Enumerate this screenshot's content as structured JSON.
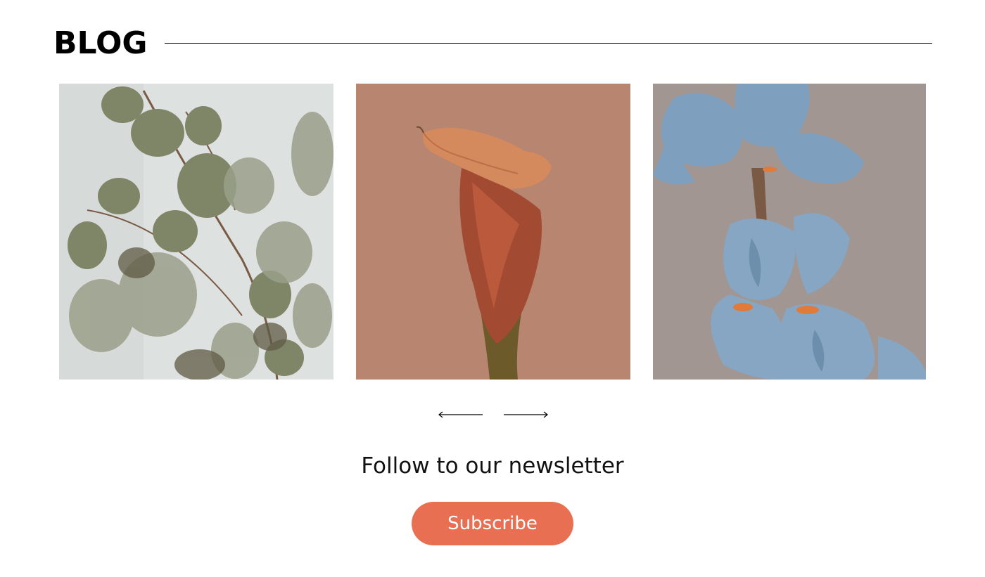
{
  "section": {
    "title": "BLOG"
  },
  "posts": [
    {
      "image": "eucalyptus-branch-photo"
    },
    {
      "image": "calla-lily-photo"
    },
    {
      "image": "blue-iris-photo"
    }
  ],
  "carousel": {
    "prev_icon": "arrow-left-icon",
    "next_icon": "arrow-right-icon"
  },
  "newsletter": {
    "heading": "Follow to our newsletter",
    "button_label": "Subscribe"
  },
  "colors": {
    "accent": "#e86f52",
    "calla_background": "#b88570",
    "eucalyptus_background": "#dde1e0",
    "iris_background": "#a79d98"
  }
}
